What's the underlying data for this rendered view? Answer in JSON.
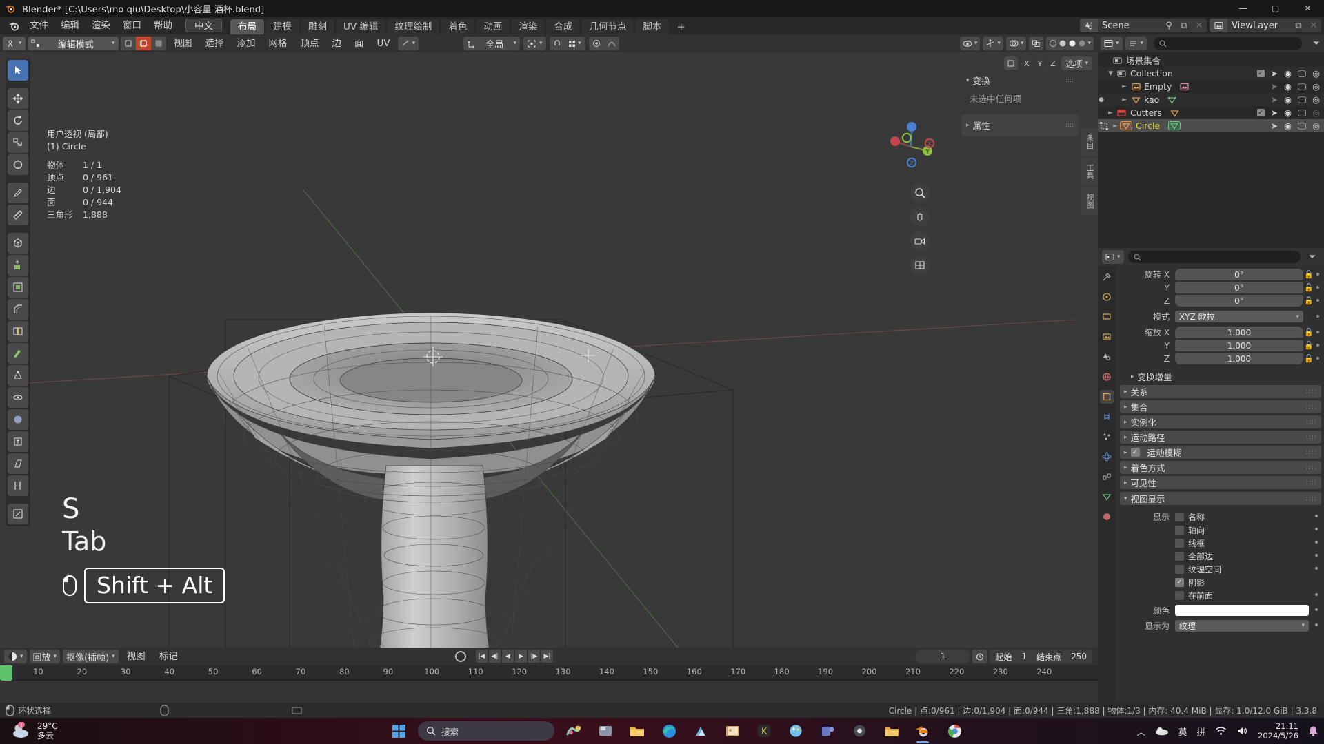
{
  "window": {
    "title": "Blender* [C:\\Users\\mo qiu\\Desktop\\小容量 酒杯.blend]",
    "minimize": "—",
    "maximize": "▢",
    "close": "✕"
  },
  "topbar": {
    "menus": [
      "文件",
      "编辑",
      "渲染",
      "窗口",
      "帮助"
    ],
    "language": "中文",
    "workspace_tabs": [
      "布局",
      "建模",
      "雕刻",
      "UV 编辑",
      "纹理绘制",
      "着色",
      "动画",
      "渲染",
      "合成",
      "几何节点",
      "脚本"
    ],
    "active_workspace": "布局",
    "add_tab": "+",
    "scene_name": "Scene",
    "viewlayer_name": "ViewLayer"
  },
  "viewport_header": {
    "mode": "编辑模式",
    "menus": [
      "视图",
      "选择",
      "添加",
      "网格",
      "顶点",
      "边",
      "面",
      "UV"
    ],
    "transform_orientation": "全局",
    "select_mode_icons": [
      "vertex-select-icon",
      "edge-select-icon",
      "face-select-icon"
    ]
  },
  "viewport": {
    "overlay_stats": {
      "perspective": "用户透视 (局部)",
      "object_line": "(1) Circle",
      "rows": [
        {
          "label": "物体",
          "value": "1 / 1"
        },
        {
          "label": "顶点",
          "value": "0 / 961"
        },
        {
          "label": "边",
          "value": "0 / 1,904"
        },
        {
          "label": "面",
          "value": "0 / 944"
        },
        {
          "label": "三角形",
          "value": "1,888"
        }
      ]
    },
    "gizmo_axes": [
      "X",
      "Y",
      "Z"
    ],
    "proportional_dropdown": "选项",
    "xyz_buttons": [
      "X",
      "Y",
      "Z"
    ],
    "key_overlay": {
      "line1": "S",
      "line2": "Tab",
      "combo": "Shift + Alt"
    }
  },
  "npanel": {
    "title": "变换",
    "empty_text": "未选中任何项",
    "section": "属性",
    "tabs": [
      "条目",
      "工具",
      "视图"
    ]
  },
  "timeline": {
    "playback_label": "回放",
    "keying_label": "抠像(插帧)",
    "menus": [
      "视图",
      "标记"
    ],
    "current_frame": "1",
    "start_label": "起始",
    "start_value": "1",
    "end_label": "结束点",
    "end_value": "250",
    "ticks": [
      "10",
      "20",
      "30",
      "40",
      "50",
      "60",
      "70",
      "80",
      "90",
      "100",
      "110",
      "120",
      "130",
      "140",
      "150",
      "160",
      "170",
      "180",
      "190",
      "200",
      "210",
      "220",
      "230",
      "240"
    ]
  },
  "outliner": {
    "scene_collection": "场景集合",
    "search_placeholder": "",
    "rows": [
      {
        "name": "Collection",
        "indent": 1,
        "expand": "▼",
        "type": "collection",
        "checkbox": true,
        "selected": false
      },
      {
        "name": "Empty",
        "indent": 2,
        "expand": "►",
        "type": "empty",
        "checkbox": false,
        "selected": false
      },
      {
        "name": "kao",
        "indent": 2,
        "expand": "►",
        "type": "mesh",
        "checkbox": false,
        "selected": false
      },
      {
        "name": "Cutters",
        "indent": 1,
        "expand": "►",
        "type": "collection-red",
        "checkbox": true,
        "selected": false
      },
      {
        "name": "Circle",
        "indent": 1,
        "expand": "►",
        "type": "mesh",
        "checkbox": false,
        "selected": true
      }
    ]
  },
  "properties": {
    "search_placeholder": "",
    "tabs": [
      "tool-icon",
      "render-icon",
      "output-icon",
      "viewlayer-icon",
      "scene-icon",
      "world-icon",
      "object-icon",
      "modifier-icon",
      "particles-icon",
      "physics-icon",
      "constraint-icon",
      "data-icon",
      "material-icon"
    ],
    "transform": {
      "rotation_label": "旋转",
      "rotation": [
        {
          "axis": "X",
          "value": "0°"
        },
        {
          "axis": "Y",
          "value": "0°"
        },
        {
          "axis": "Z",
          "value": "0°"
        }
      ],
      "mode_label": "模式",
      "mode_value": "XYZ 欧拉",
      "scale_label": "缩放",
      "scale": [
        {
          "axis": "X",
          "value": "1.000"
        },
        {
          "axis": "Y",
          "value": "1.000"
        },
        {
          "axis": "Z",
          "value": "1.000"
        }
      ]
    },
    "sections": [
      {
        "label": "变换增量",
        "open": false,
        "plain": true,
        "checkbox": null
      },
      {
        "label": "关系",
        "open": false,
        "plain": false,
        "checkbox": null
      },
      {
        "label": "集合",
        "open": false,
        "plain": false,
        "checkbox": null
      },
      {
        "label": "实例化",
        "open": false,
        "plain": false,
        "checkbox": null
      },
      {
        "label": "运动路径",
        "open": false,
        "plain": false,
        "checkbox": null
      },
      {
        "label": "运动模糊",
        "open": false,
        "plain": false,
        "checkbox": true
      },
      {
        "label": "着色方式",
        "open": false,
        "plain": false,
        "checkbox": null
      },
      {
        "label": "可见性",
        "open": false,
        "plain": false,
        "checkbox": null
      }
    ],
    "viewport_display": {
      "title": "视图显示",
      "show_label": "显示",
      "checkboxes": [
        {
          "label": "名称",
          "checked": false
        },
        {
          "label": "轴向",
          "checked": false
        },
        {
          "label": "线框",
          "checked": false
        },
        {
          "label": "全部边",
          "checked": false
        },
        {
          "label": "纹理空间",
          "checked": false
        },
        {
          "label": "阴影",
          "checked": true
        },
        {
          "label": "在前面",
          "checked": false
        }
      ],
      "color_label": "颜色",
      "color_value": "#ffffff",
      "display_as_label": "显示为",
      "display_as_value": "纹理"
    }
  },
  "statusbar": {
    "left_hint": "环状选择",
    "right_info": "Circle | 点:0/961 | 边:0/1,904 | 面:0/944 | 三角:1,888 | 物体:1/3 | 内存: 40.4 MiB | 显存: 1.0/12.0 GiB | 3.3.8"
  },
  "taskbar": {
    "weather_temp": "29°C",
    "weather_desc": "多云",
    "search_placeholder": "搜索",
    "clock_time": "21:11",
    "clock_date": "2024/5/26",
    "ime_lang": "英",
    "ime_mode": "拼"
  },
  "colors": {
    "accent_blue": "#4772b3",
    "select_orange": "#e98b3a",
    "active_red": "#c1462a",
    "axis_x": "#c1474a",
    "axis_y": "#8cbf3f",
    "axis_z": "#4b7fd4",
    "outliner_selected": "#dcd23c",
    "playhead_green": "#5ec269"
  }
}
